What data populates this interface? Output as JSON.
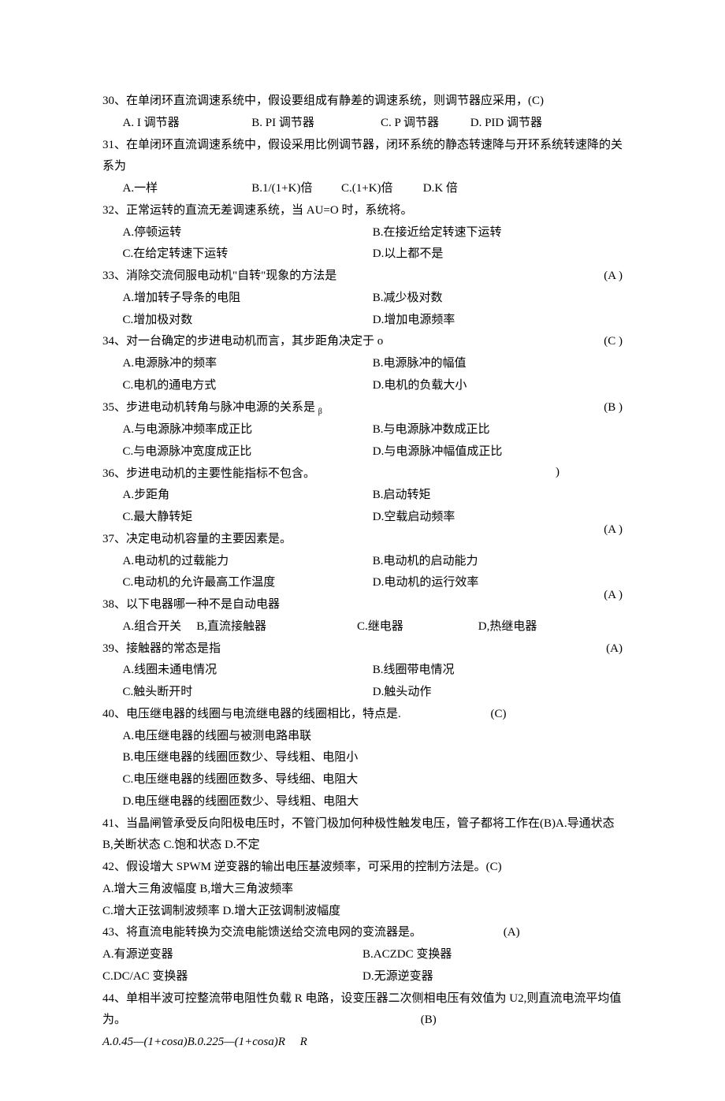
{
  "q30": {
    "stem": "30、在单闭环直流调速系统中，假设要组成有静差的调速系统，则调节器应采用，(C)",
    "a": "A. I 调节器",
    "b": "B.  PI 调节器",
    "c": "C.  P 调节器",
    "d": "D. PID 调节器"
  },
  "q31": {
    "stem": "31、在单闭环直流调速系统中，假设采用比例调节器，闭环系统的静态转速降与开环系统转速降的关系为",
    "a": "A.一样",
    "b": "B.1/(1+K)倍",
    "c": "C.(1+K)倍",
    "d": "D.K 倍"
  },
  "q32": {
    "stem": "32、正常运转的直流无差调速系统，当 AU=O 时，系统将。",
    "a": "A.停顿运转",
    "b": "B.在接近给定转速下运转",
    "c": "C.在给定转速下运转",
    "d": "D.以上都不是"
  },
  "q33": {
    "stem": "33、消除交流伺服电动机\"自转\"现象的方法是",
    "answer": "(A )",
    "a": "A.增加转子导条的电阻",
    "b": "B.减少极对数",
    "c": "C.增加极对数",
    "d": "D.增加电源频率"
  },
  "q34": {
    "stem": "34、对一台确定的步进电动机而言，其步距角决定于 o",
    "answer": "(C )",
    "a": "A.电源脉冲的频率",
    "b": "B.电源脉冲的幅值",
    "c": "C.电机的通电方式",
    "d": "D.电机的负载大小"
  },
  "q35": {
    "stem": "35、步进电动机转角与脉冲电源的关系是 ",
    "sub": "β",
    "answer": "(B )",
    "a": "A.与电源脉冲频率成正比",
    "b": "B.与电源脉冲数成正比",
    "c": "C.与电源脉冲宽度成正比",
    "d": "D.与电源脉冲幅值成正比"
  },
  "q36": {
    "stem": "36、步进电动机的主要性能指标不包含。",
    "answer": ")",
    "a": "A.步距角",
    "b": "B.启动转矩",
    "c": "C.最大静转矩",
    "d": "D.空载启动频率"
  },
  "q37": {
    "stem": "37、决定电动机容量的主要因素是。",
    "answer": "(A )",
    "a": "A.电动机的过载能力",
    "b": "B.电动机的启动能力",
    "c": "C.电动机的允许最高工作温度",
    "d": "D.电动机的运行效率"
  },
  "q38": {
    "stem": "38、以下电器哪一种不是自动电器",
    "answer": "(A )",
    "a": "A.组合开关",
    "b": "B,直流接触器",
    "c": "C.继电器",
    "d": "D,热继电器"
  },
  "q39": {
    "stem": "39、接触器的常态是指",
    "answer": "(A)",
    "a": "A.线圈未通电情况",
    "b": "B.线圈带电情况",
    "c": "C.触头断开时",
    "d": "D.触头动作"
  },
  "q40": {
    "stem": "40、电压继电器的线圈与电流继电器的线圈相比，特点是.",
    "answer": "(C)",
    "a": "A.电压继电器的线圈与被测电路串联",
    "b": "B.电压继电器的线圈匝数少、导线粗、电阻小",
    "c": "C.电压继电器的线圈匝数多、导线细、电阻大",
    "d": "D.电压继电器的线圈匝数少、导线粗、电阻大"
  },
  "q41": {
    "stem": "41、当晶闸管承受反向阳极电压时，不管门极加何种极性触发电压，管子都将工作在(B)A.导通状态 B,关断状态 C.饱和状态 D.不定"
  },
  "q42": {
    "stem": "42、假设增大 SPWM 逆变器的输出电压基波频率，可采用的控制方法是。(C)",
    "ab": "A.增大三角波幅度 B,增大三角波频率",
    "cd": "C.增大正弦调制波频率 D.增大正弦调制波幅度"
  },
  "q43": {
    "stem": "43、将直流电能转换为交流电能馈送给交流电网的变流器是。",
    "answer": "(A)",
    "a": "A.有源逆变器",
    "b": "B.ACZDC 变换器",
    "c": "C.DC/AC 变换器",
    "d": "D.无源逆变器"
  },
  "q44": {
    "stem": "44、单相半波可控整流带电阻性负载 R 电路，设变压器二次侧相电压有效值为 U2,则直流电流平均值为。",
    "answer": "(B)",
    "opts": "A.0.45—(1+cosa)B.0.225—(1+cosa)R     R"
  }
}
